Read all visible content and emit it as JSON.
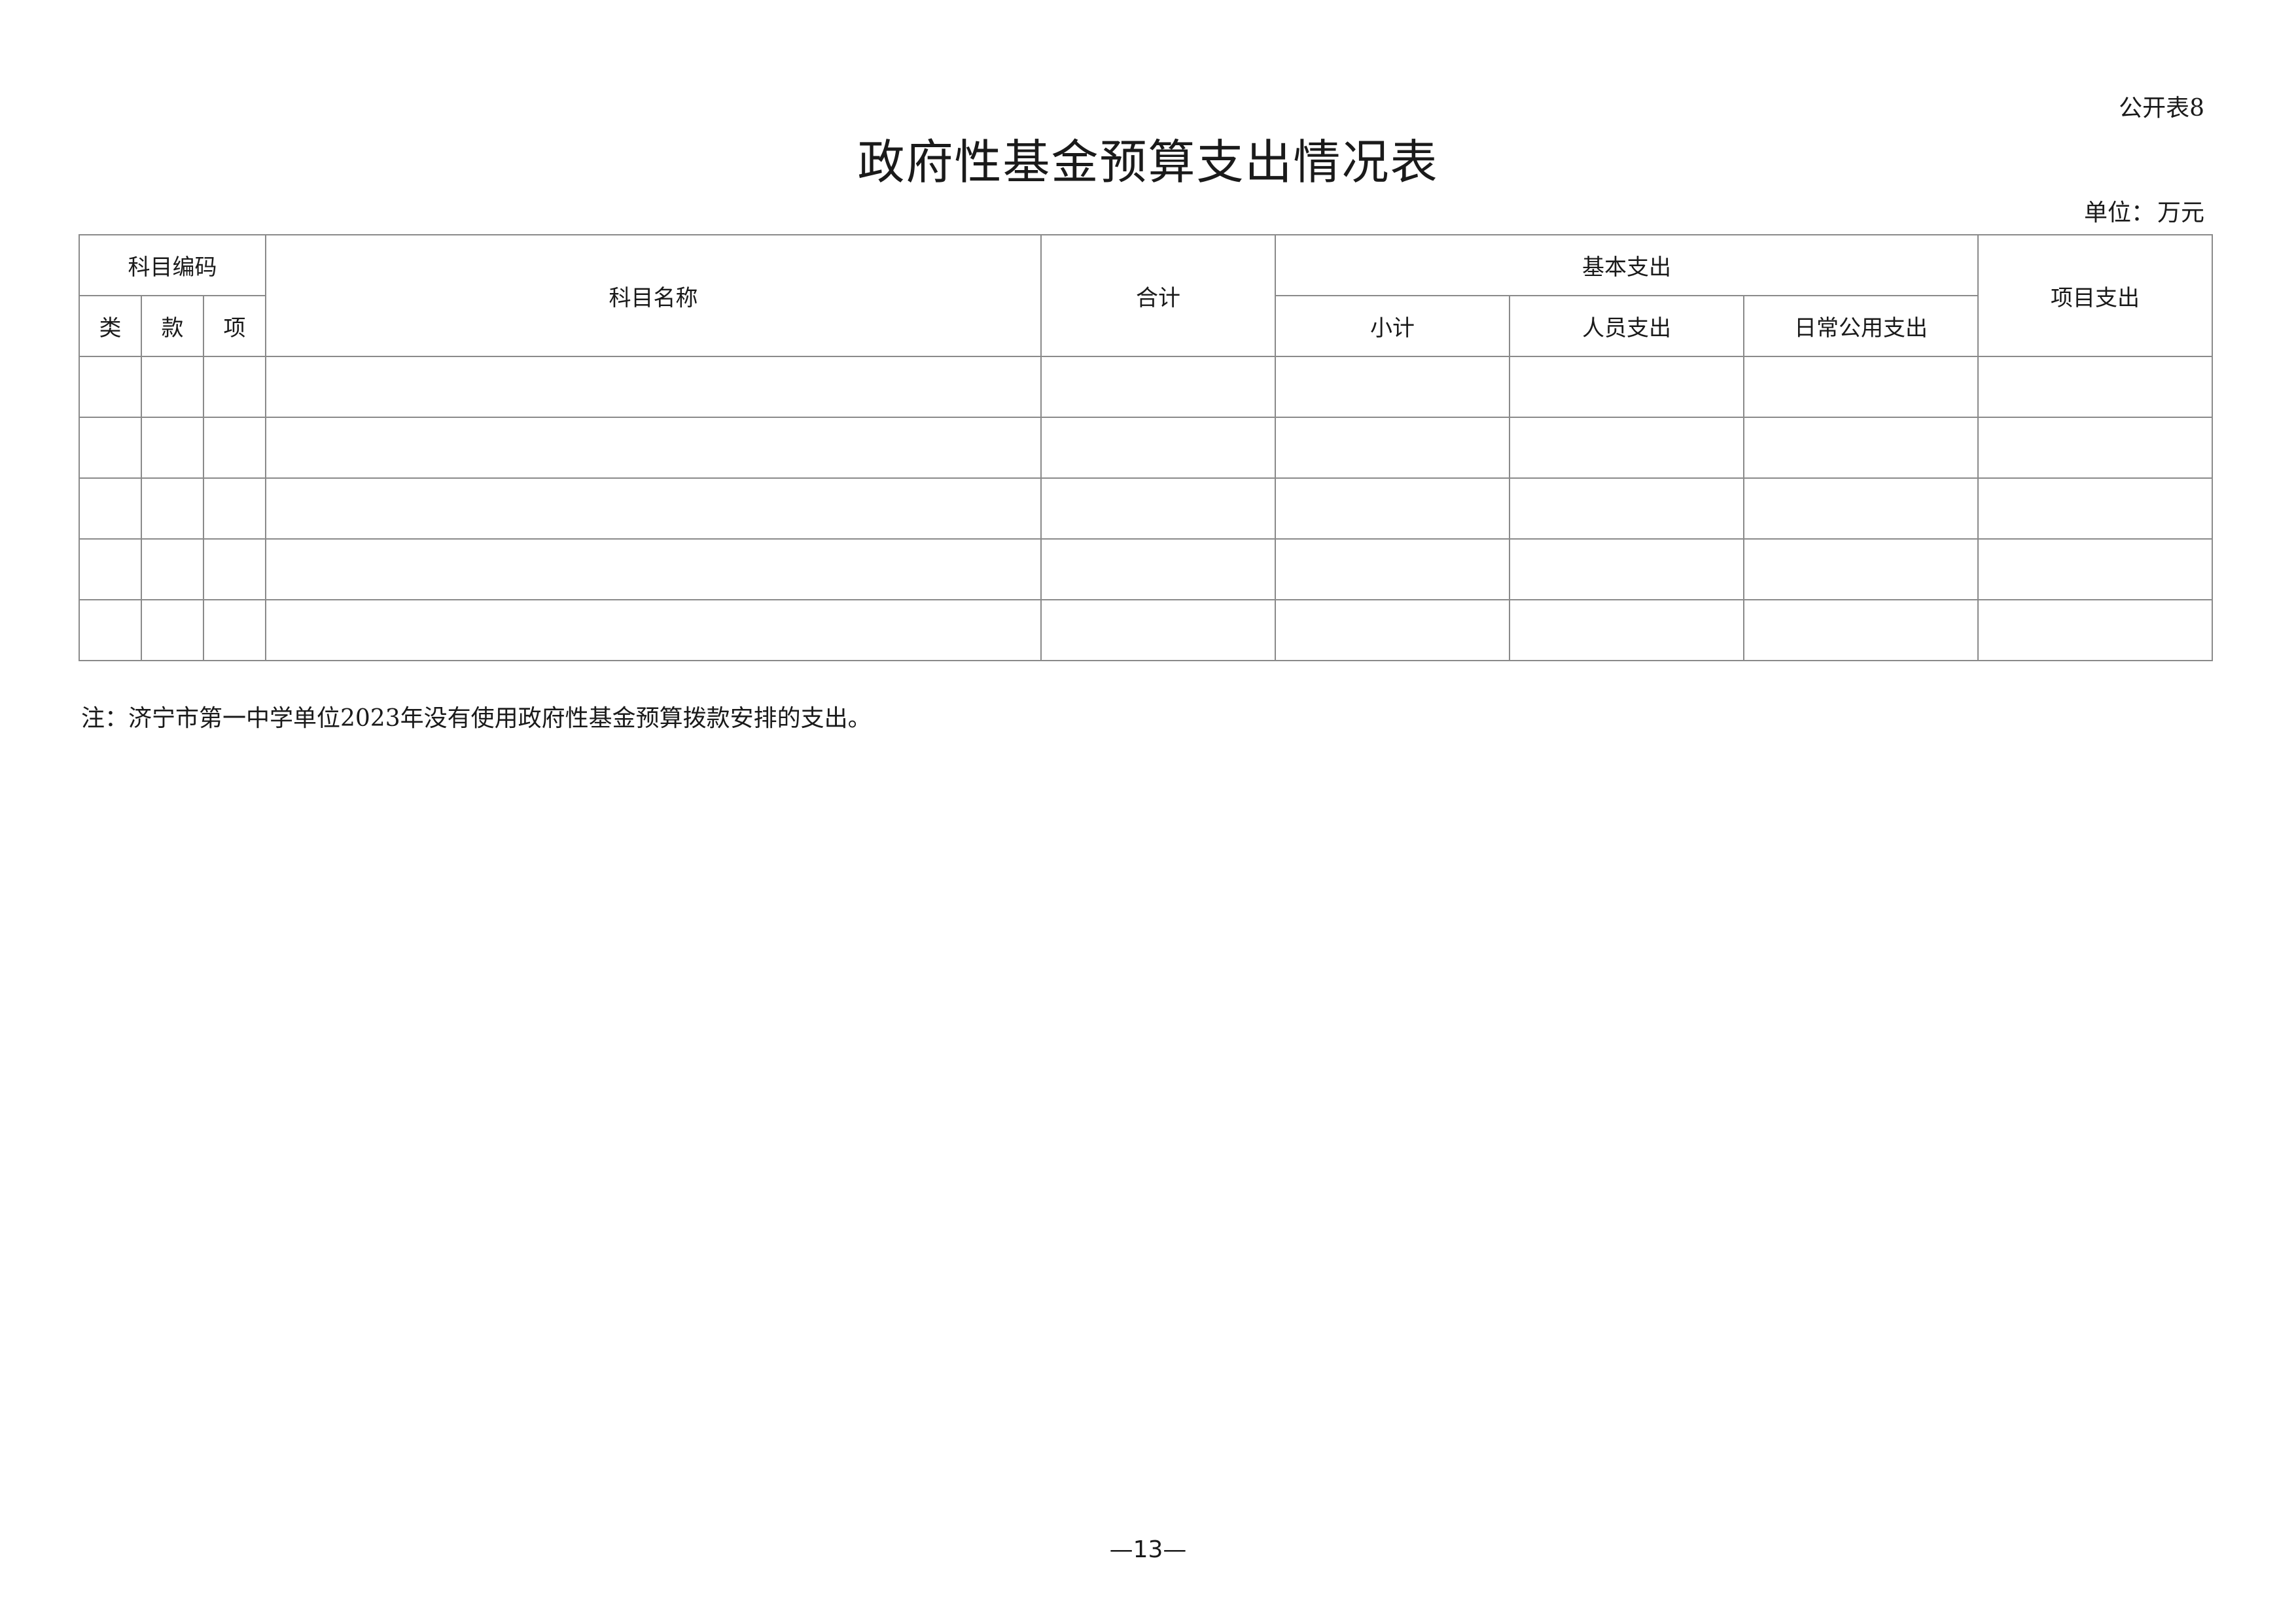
{
  "header": {
    "table_ref": "公开表8",
    "title": "政府性基金预算支出情况表",
    "unit_label": "单位：",
    "unit_value": "万元"
  },
  "table": {
    "headers": {
      "subject_code": "科目编码",
      "category": "类",
      "section": "款",
      "item": "项",
      "subject_name": "科目名称",
      "total": "合计",
      "basic_expenditure": "基本支出",
      "subtotal": "小计",
      "personnel": "人员支出",
      "public_daily": "日常公用支出",
      "project_expenditure": "项目支出"
    },
    "rows": [
      [
        "",
        "",
        "",
        "",
        "",
        "",
        "",
        "",
        ""
      ],
      [
        "",
        "",
        "",
        "",
        "",
        "",
        "",
        "",
        ""
      ],
      [
        "",
        "",
        "",
        "",
        "",
        "",
        "",
        "",
        ""
      ],
      [
        "",
        "",
        "",
        "",
        "",
        "",
        "",
        "",
        ""
      ],
      [
        "",
        "",
        "",
        "",
        "",
        "",
        "",
        "",
        ""
      ]
    ]
  },
  "note": "注：济宁市第一中学单位2023年没有使用政府性基金预算拨款安排的支出。",
  "page_number": "—13—"
}
